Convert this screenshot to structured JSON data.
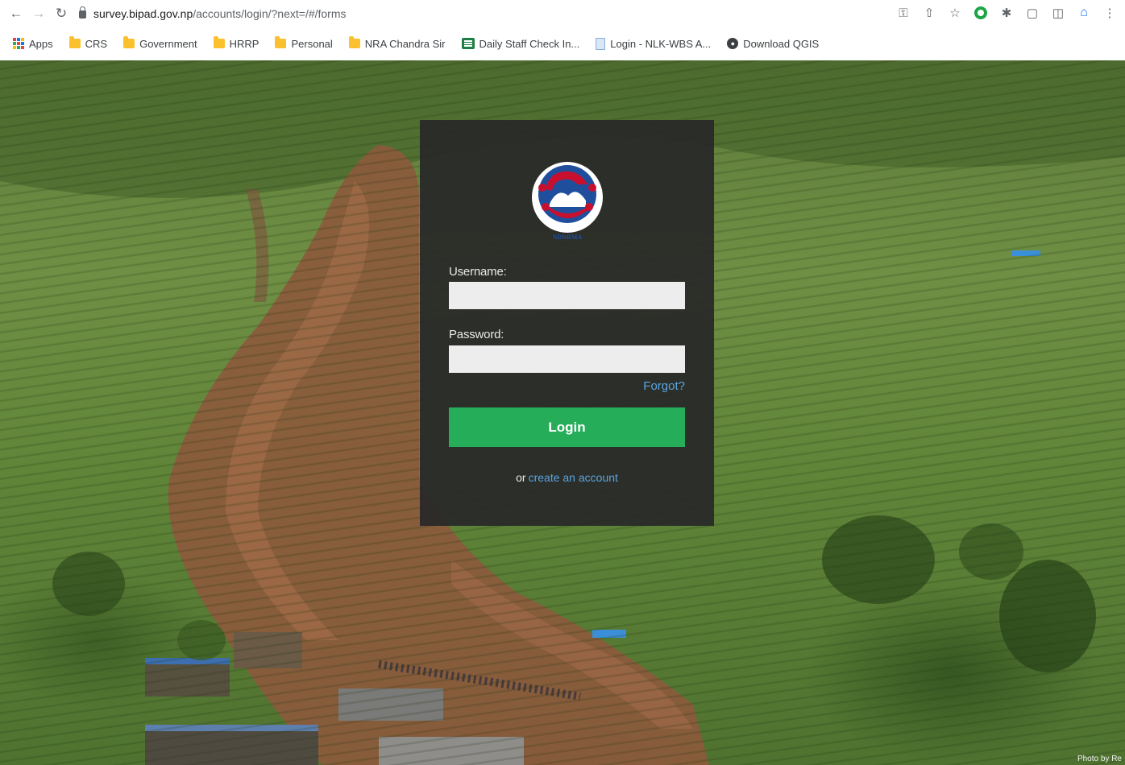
{
  "browser": {
    "url_host": "survey.bipad.gov.np",
    "url_path": "/accounts/login/?next=/#/forms",
    "bookmarks": [
      {
        "label": "Apps",
        "icon": "apps-grid-icon"
      },
      {
        "label": "CRS",
        "icon": "folder-icon"
      },
      {
        "label": "Government",
        "icon": "folder-icon"
      },
      {
        "label": "HRRP",
        "icon": "folder-icon"
      },
      {
        "label": "Personal",
        "icon": "folder-icon"
      },
      {
        "label": "NRA Chandra Sir",
        "icon": "folder-icon"
      },
      {
        "label": "Daily Staff Check In...",
        "icon": "sheets-icon"
      },
      {
        "label": "Login - NLK-WBS A...",
        "icon": "document-icon"
      },
      {
        "label": "Download QGIS",
        "icon": "globe-icon"
      }
    ]
  },
  "login": {
    "logo_text": "NDRRMA",
    "username_label": "Username:",
    "password_label": "Password:",
    "username_value": "",
    "password_value": "",
    "forgot_label": "Forgot?",
    "login_label": "Login",
    "or_text": "or",
    "create_account_label": "create an account"
  },
  "background": {
    "photo_credit": "Photo by Re"
  },
  "colors": {
    "card_bg": "#282828",
    "login_button": "#26ad5a",
    "link": "#5aa4e0"
  }
}
